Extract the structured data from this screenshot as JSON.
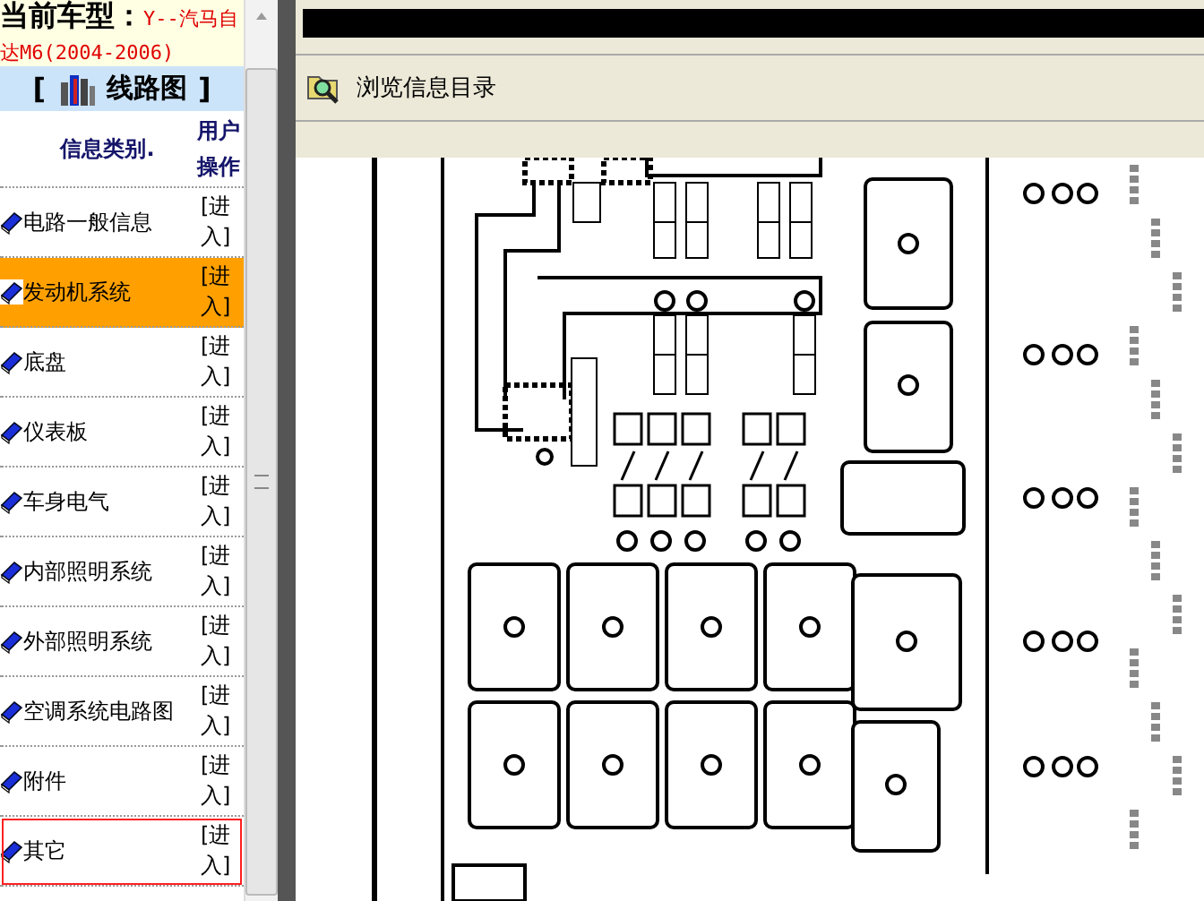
{
  "car_model": {
    "label": "当前车型：",
    "value": "Y--汽马自达M6(2004-2006)"
  },
  "section": {
    "open": "[",
    "title": "线路图",
    "close": "]"
  },
  "columns": [
    "信息类别.",
    "用户操作"
  ],
  "rows": [
    {
      "label": "电路一般信息",
      "action": "[进入]",
      "selected": false,
      "focused": false
    },
    {
      "label": "发动机系统",
      "action": "[进入]",
      "selected": true,
      "focused": false
    },
    {
      "label": "底盘",
      "action": "[进入]",
      "selected": false,
      "focused": false
    },
    {
      "label": "仪表板",
      "action": "[进入]",
      "selected": false,
      "focused": false
    },
    {
      "label": "车身电气",
      "action": "[进入]",
      "selected": false,
      "focused": false
    },
    {
      "label": "内部照明系统",
      "action": "[进入]",
      "selected": false,
      "focused": false
    },
    {
      "label": "外部照明系统",
      "action": "[进入]",
      "selected": false,
      "focused": false
    },
    {
      "label": "空调系统电路图",
      "action": "[进入]",
      "selected": false,
      "focused": false
    },
    {
      "label": "附件",
      "action": "[进入]",
      "selected": false,
      "focused": false
    },
    {
      "label": "其它",
      "action": "[进入]",
      "selected": false,
      "focused": true
    }
  ],
  "toolbar": {
    "label": "浏览信息目录"
  }
}
